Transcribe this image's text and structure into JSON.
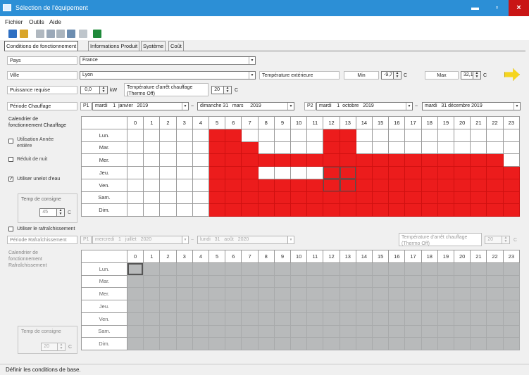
{
  "window": {
    "title": "Sélection de l'équipement",
    "minimize": "▬",
    "maximize": "▫",
    "close": "×"
  },
  "menu": [
    "Fichier",
    "Outils",
    "Aide"
  ],
  "tabs": [
    "Conditions de fonctionnement",
    "Informations Produit",
    "Système",
    "Coût"
  ],
  "form": {
    "pays_label": "Pays",
    "pays_value": "France",
    "ville_label": "Ville",
    "ville_value": "Lyon",
    "temp_ext_label": "Température extérieure",
    "min_label": "Min",
    "min_value": "-9,7",
    "max_label": "Max",
    "max_value": "32,1",
    "unit_c": "C",
    "puissance_label": "Puissance requise",
    "puissance_value": "0,0",
    "puissance_unit": "kW",
    "arret_label": "Température d'arrêt chauffage\n(Thermo Off)",
    "arret_value": "20",
    "periode_label": "Période Chauffage",
    "p1": "P1",
    "p1_start": "mardi    1  janvier   2019",
    "sep": "~",
    "p1_end": "dimanche 31   mars     2019",
    "p2": "P2",
    "p2_start": "mardi    1  octobre   2019",
    "p2_end": "mardi   31 décembre 2019",
    "calendrier_chauffage_label": "Calendrier de\nfonctionnement Chauffage",
    "annee_entiere_label": "Utilisation Année\nentière",
    "reduit_nuit_label": "Réduit de nuit",
    "unelot_label": "Utiliser unelot d'eau",
    "consigne_label": "Temp de consigne",
    "consigne_value": "45",
    "rafraichissement_check_label": "Utiliser le rafraîchissement",
    "periode_raf_label": "Période Rafraîchissement",
    "raf_p1_start": "mercredi   1   juillet   2020",
    "raf_p1_end": "lundi   31   août   2020",
    "raf_arret_label": "Température d'arrêt chauffage\n(Thermo Off)",
    "raf_arret_value": "20",
    "calendrier_raf_label": "Calendrier de\nfonctionnement\nRafraîchissement",
    "raf_consigne_label": "Temp de consigne",
    "raf_consigne_value": "20"
  },
  "hours": [
    "0",
    "1",
    "2",
    "3",
    "4",
    "5",
    "6",
    "7",
    "8",
    "9",
    "10",
    "11",
    "12",
    "13",
    "14",
    "15",
    "16",
    "17",
    "18",
    "19",
    "20",
    "21",
    "22",
    "23"
  ],
  "days": [
    "Lun.",
    "Mar.",
    "Mer.",
    "Jeu.",
    "Ven.",
    "Sam.",
    "Dim."
  ],
  "heating_active": {
    "Lun.": [
      5,
      6,
      12,
      13
    ],
    "Mar.": [
      5,
      6,
      7,
      12,
      13
    ],
    "Mer.": [
      5,
      6,
      7,
      8,
      9,
      10,
      11,
      12,
      13,
      14,
      15,
      16,
      17,
      18,
      19,
      20,
      21,
      22
    ],
    "Jeu.": [
      5,
      6,
      7,
      12,
      13,
      14,
      15,
      16,
      17,
      18,
      19,
      20,
      21,
      22,
      23
    ],
    "Ven.": [
      5,
      6,
      7,
      8,
      9,
      10,
      11,
      12,
      13,
      14,
      15,
      16,
      17,
      18,
      19,
      20,
      21,
      22,
      23
    ],
    "Sam.": [
      5,
      6,
      7,
      8,
      9,
      10,
      11,
      12,
      13,
      14,
      15,
      16,
      17,
      18,
      19,
      20,
      21,
      22,
      23
    ],
    "Dim.": [
      5,
      6,
      7,
      8,
      9,
      10,
      11,
      12,
      13,
      14,
      15,
      16,
      17,
      18,
      19,
      20,
      21,
      22,
      23
    ]
  },
  "status": "Définir les conditions de base.",
  "colors": {
    "titlebar": "#2c8fd6",
    "active": "#ec1c1c",
    "disabled": "#b8babb"
  }
}
